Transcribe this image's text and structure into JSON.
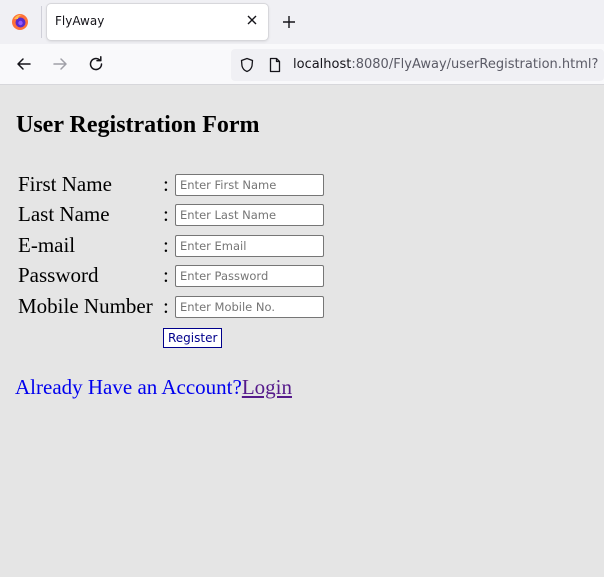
{
  "browser": {
    "tab_title": "FlyAway",
    "url_host": "localhost",
    "url_path": ":8080/FlyAway/userRegistration.html?"
  },
  "icons": {
    "logo": "firefox-logo",
    "tab_close": "close-icon",
    "new_tab": "plus-icon",
    "back": "back-arrow-icon",
    "forward": "forward-arrow-icon",
    "reload": "reload-icon",
    "tracking": "shield-icon",
    "page": "page-icon"
  },
  "form": {
    "title": "User Registration Form",
    "fields": [
      {
        "label": "First Name",
        "placeholder": "Enter First Name",
        "value": ""
      },
      {
        "label": "Last Name",
        "placeholder": "Enter Last Name",
        "value": ""
      },
      {
        "label": "E-mail",
        "placeholder": "Enter Email",
        "value": ""
      },
      {
        "label": "Password",
        "placeholder": "Enter Password",
        "value": ""
      },
      {
        "label": "Mobile Number",
        "placeholder": "Enter Mobile No.",
        "value": ""
      }
    ],
    "colon": ":",
    "register_label": "Register"
  },
  "footer": {
    "account_text": "Already Have an Account?",
    "login_label": "Login"
  },
  "colors": {
    "page_background": "#e5e5e5",
    "account_text": "#0000ee",
    "visited_link": "#551a8b",
    "register_border": "#00008b"
  }
}
